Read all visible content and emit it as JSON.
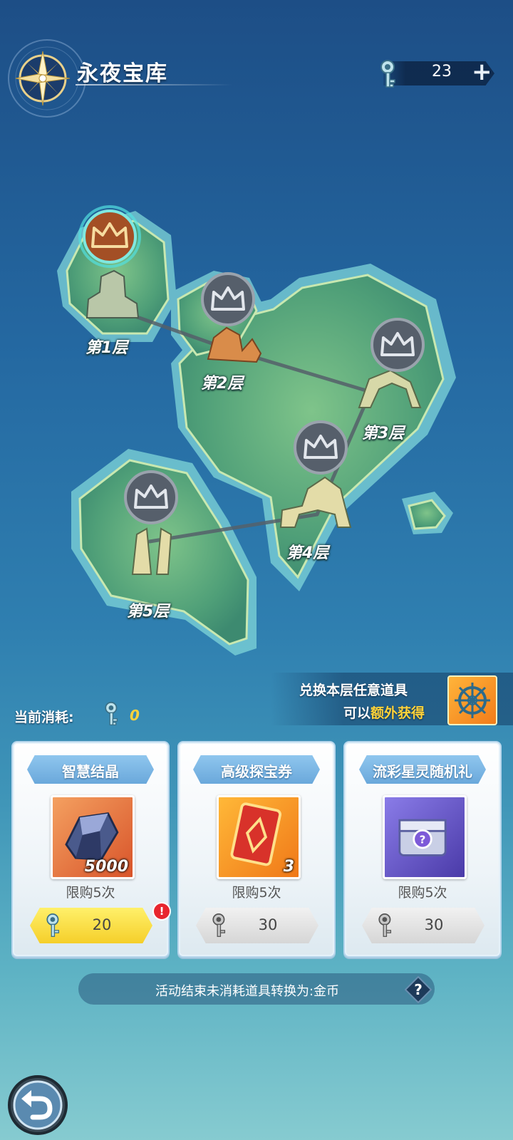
{
  "header": {
    "title": "永夜宝库",
    "key_count": "23",
    "add_label": "+"
  },
  "map": {
    "floors": [
      {
        "label": "第1层",
        "status": "current"
      },
      {
        "label": "第2层",
        "status": "locked"
      },
      {
        "label": "第3层",
        "status": "locked"
      },
      {
        "label": "第4层",
        "status": "locked"
      },
      {
        "label": "第5层",
        "status": "locked"
      }
    ]
  },
  "exchange_tip": {
    "line1": "兑换本层任意道具",
    "line2_prefix": "可以",
    "line2_highlight": "额外获得"
  },
  "consumption": {
    "label": "当前消耗:",
    "value": "0"
  },
  "shop": {
    "items": [
      {
        "name": "智慧结晶",
        "quantity": "5000",
        "limit": "限购5次",
        "price": "20",
        "affordable": true,
        "alert": "!"
      },
      {
        "name": "高级探宝券",
        "quantity": "3",
        "limit": "限购5次",
        "price": "30",
        "affordable": false
      },
      {
        "name": "流彩星灵随机礼",
        "quantity": "",
        "limit": "限购5次",
        "price": "30",
        "affordable": false
      }
    ]
  },
  "footer": {
    "note": "活动结束未消耗道具转换为:金币",
    "help_label": "?"
  },
  "colors": {
    "highlight": "#ffd33a",
    "active_button": "#f5cf2a",
    "card_title": "#6aa8db",
    "alert_badge": "#e8262e"
  },
  "icons": [
    "compass-icon",
    "key-icon",
    "plus-icon",
    "crown-icon",
    "ship-wheel-icon",
    "crystal-icon",
    "ticket-card-icon",
    "star-chest-icon",
    "help-icon",
    "back-arrow-icon"
  ]
}
